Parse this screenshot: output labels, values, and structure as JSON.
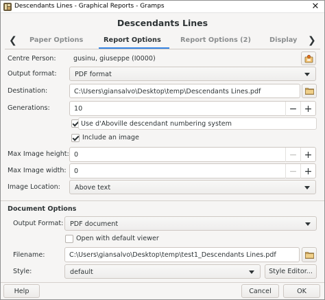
{
  "window": {
    "title": "Descendants Lines - Graphical Reports - Gramps",
    "close_glyph": "✕"
  },
  "dialog": {
    "title": "Descendants Lines"
  },
  "tabs": [
    {
      "label": "Paper Options"
    },
    {
      "label": "Report Options"
    },
    {
      "label": "Report Options (2)"
    },
    {
      "label": "Display"
    }
  ],
  "tab_arrows": {
    "left": "❮",
    "right": "❯"
  },
  "report": {
    "centre_person_label": "Centre Person:",
    "centre_person_value": "gusinu, giuseppe (I0000)",
    "output_format_label": "Output format:",
    "output_format_value": "PDF format",
    "destination_label": "Destination:",
    "destination_value": "C:\\Users\\giansalvo\\Desktop\\temp\\Descendants Lines.pdf",
    "generations_label": "Generations:",
    "generations_value": "10",
    "daboville_label": "Use d'Aboville descendant numbering system",
    "daboville_checked": true,
    "include_image_label": "Include an image",
    "include_image_checked": true,
    "image_height_label": "Max Image height:",
    "image_height_value": "0",
    "image_width_label": "Max Image width:",
    "image_width_value": "0",
    "image_location_label": "Image Location:",
    "image_location_value": "Above text"
  },
  "stepper": {
    "minus": "−",
    "plus": "+"
  },
  "document": {
    "section_label": "Document Options",
    "output_format_label": "Output Format:",
    "output_format_value": "PDF document",
    "open_viewer_label": "Open with default viewer",
    "open_viewer_checked": false,
    "filename_label": "Filename:",
    "filename_value": "C:\\Users\\giansalvo\\Desktop\\temp\\test1_Descendants Lines.pdf",
    "style_label": "Style:",
    "style_value": "default",
    "style_editor_label": "Style Editor..."
  },
  "buttons": {
    "help": "Help",
    "cancel": "Cancel",
    "ok": "OK"
  },
  "colors": {
    "accent": "#3584e4",
    "background": "#f6f5f4"
  }
}
